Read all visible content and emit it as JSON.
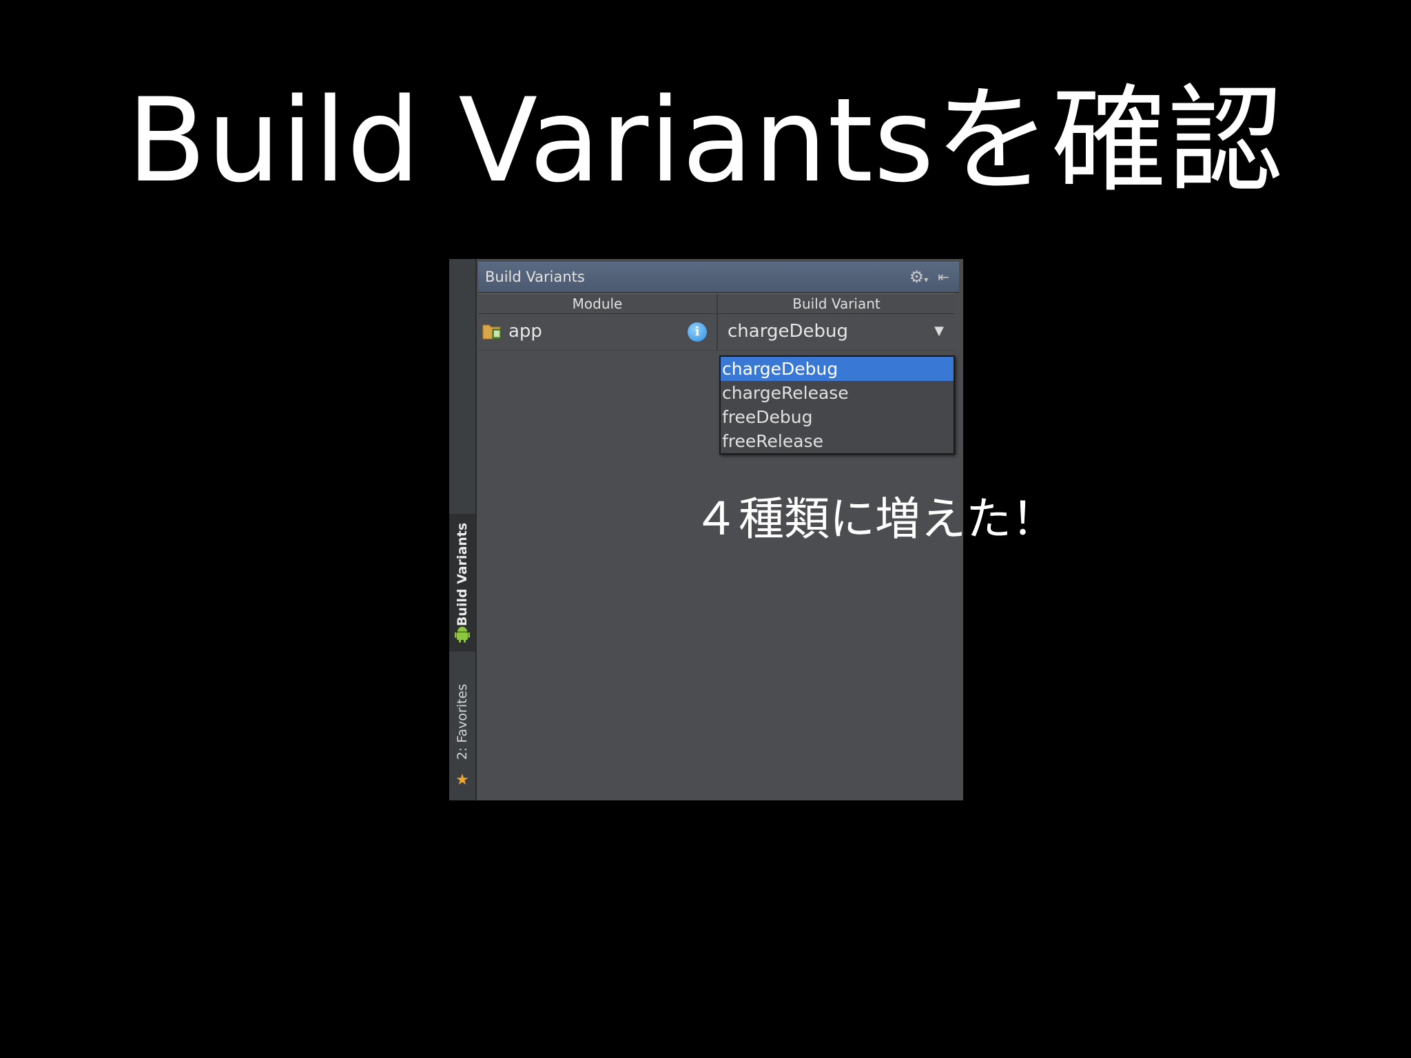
{
  "slide": {
    "title": "Build Variantsを確認",
    "annotation": "４種類に増えた！"
  },
  "sidebar": {
    "tabs": [
      {
        "label": "Build Variants",
        "icon": "android-icon",
        "active": true
      },
      {
        "label": "2: Favorites",
        "icon": "star-icon",
        "active": false
      }
    ]
  },
  "panel": {
    "title": "Build Variants",
    "header_icons": [
      "gear-icon",
      "hide-panel-icon"
    ],
    "columns": {
      "module": "Module",
      "build_variant": "Build Variant"
    },
    "rows": [
      {
        "module": "app",
        "build_variant": "chargeDebug"
      }
    ],
    "dropdown": {
      "selected": "chargeDebug",
      "options": [
        "chargeDebug",
        "chargeRelease",
        "freeDebug",
        "freeRelease"
      ]
    }
  },
  "colors": {
    "background": "#000000",
    "panel": "#4b4d50",
    "header": "#51607a",
    "selection": "#3a78d6"
  }
}
